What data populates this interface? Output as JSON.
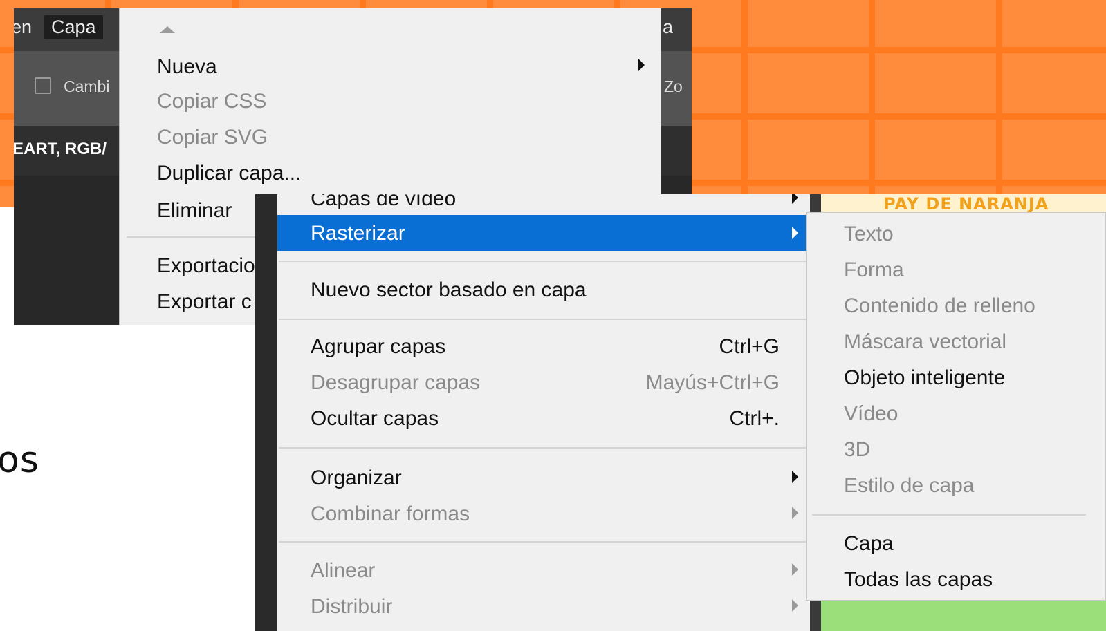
{
  "background": {
    "partial_text": "os"
  },
  "window1": {
    "menubar": {
      "left_fragment": "en",
      "active_menu": "Capa",
      "right_fragment": "a"
    },
    "options_bar": {
      "checkbox_label": "Cambi",
      "right_fragment": "Zo"
    },
    "doc_tab_text": "EART, RGB/",
    "menu": {
      "items": [
        {
          "label": "Nueva",
          "disabled": false,
          "submenu": true
        },
        {
          "label": "Copiar CSS",
          "disabled": true
        },
        {
          "label": "Copiar SVG",
          "disabled": true
        },
        {
          "label": "Duplicar capa...",
          "disabled": false
        },
        {
          "label": "Eliminar",
          "disabled": false
        },
        {
          "label": "Exportacio",
          "disabled": false
        },
        {
          "label": "Exportar c",
          "disabled": false
        }
      ]
    }
  },
  "window2": {
    "card_text": "PAY DE NARANJA",
    "menu": {
      "items": [
        {
          "label": "Capas de vídeo",
          "disabled": false,
          "submenu": true
        },
        {
          "label": "Rasterizar",
          "highlighted": true,
          "submenu": true
        },
        {
          "label": "Nuevo sector basado en capa",
          "disabled": false
        },
        {
          "label": "Agrupar capas",
          "shortcut": "Ctrl+G",
          "disabled": false
        },
        {
          "label": "Desagrupar capas",
          "shortcut": "Mayús+Ctrl+G",
          "disabled": true
        },
        {
          "label": "Ocultar capas",
          "shortcut": "Ctrl+.",
          "disabled": false
        },
        {
          "label": "Organizar",
          "disabled": false,
          "submenu": true
        },
        {
          "label": "Combinar formas",
          "disabled": true,
          "submenu": true
        },
        {
          "label": "Alinear",
          "disabled": true,
          "submenu": true
        },
        {
          "label": "Distribuir",
          "disabled": true,
          "submenu": true
        }
      ]
    },
    "rasterizar_submenu": {
      "items": [
        {
          "label": "Texto",
          "disabled": true
        },
        {
          "label": "Forma",
          "disabled": true
        },
        {
          "label": "Contenido de relleno",
          "disabled": true
        },
        {
          "label": "Máscara vectorial",
          "disabled": true
        },
        {
          "label": "Objeto inteligente",
          "disabled": false
        },
        {
          "label": "Vídeo",
          "disabled": true
        },
        {
          "label": "3D",
          "disabled": true
        },
        {
          "label": "Estilo de capa",
          "disabled": true
        },
        {
          "label": "Capa",
          "disabled": false
        },
        {
          "label": "Todas las capas",
          "disabled": false
        }
      ]
    }
  }
}
